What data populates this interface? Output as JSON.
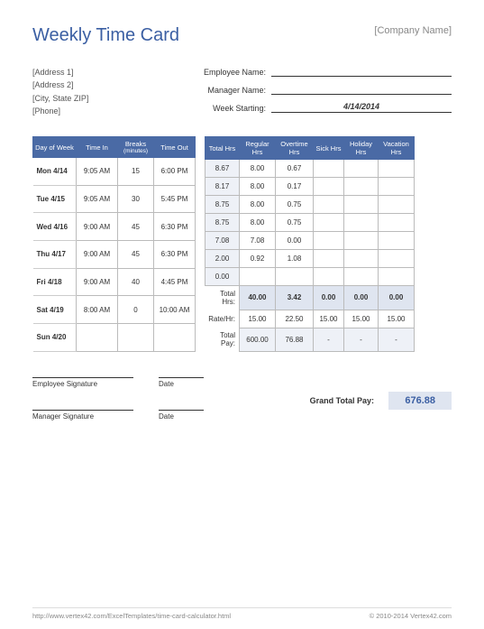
{
  "title": "Weekly Time Card",
  "company": "[Company Name]",
  "address": [
    "[Address 1]",
    "[Address 2]",
    "[City, State  ZIP]",
    "[Phone]"
  ],
  "fields": {
    "employee_label": "Employee Name:",
    "employee_value": "",
    "manager_label": "Manager Name:",
    "manager_value": "",
    "week_label": "Week Starting:",
    "week_value": "4/14/2014"
  },
  "time_table": {
    "headers": [
      "Day of Week",
      "Time In",
      "Breaks",
      "Time Out"
    ],
    "breaks_sub": "(minutes)",
    "rows": [
      {
        "day": "Mon 4/14",
        "in": "9:05 AM",
        "breaks": "15",
        "out": "6:00 PM"
      },
      {
        "day": "Tue 4/15",
        "in": "9:05 AM",
        "breaks": "30",
        "out": "5:45 PM"
      },
      {
        "day": "Wed 4/16",
        "in": "9:00 AM",
        "breaks": "45",
        "out": "6:30 PM"
      },
      {
        "day": "Thu 4/17",
        "in": "9:00 AM",
        "breaks": "45",
        "out": "6:30 PM"
      },
      {
        "day": "Fri 4/18",
        "in": "9:00 AM",
        "breaks": "40",
        "out": "4:45 PM"
      },
      {
        "day": "Sat 4/19",
        "in": "8:00 AM",
        "breaks": "0",
        "out": "10:00 AM"
      },
      {
        "day": "Sun 4/20",
        "in": "",
        "breaks": "",
        "out": ""
      }
    ]
  },
  "hrs_table": {
    "headers": [
      "Total Hrs",
      "Regular Hrs",
      "Overtime Hrs",
      "Sick Hrs",
      "Holiday Hrs",
      "Vacation Hrs"
    ],
    "rows": [
      {
        "total": "8.67",
        "reg": "8.00",
        "ot": "0.67",
        "sick": "",
        "hol": "",
        "vac": ""
      },
      {
        "total": "8.17",
        "reg": "8.00",
        "ot": "0.17",
        "sick": "",
        "hol": "",
        "vac": ""
      },
      {
        "total": "8.75",
        "reg": "8.00",
        "ot": "0.75",
        "sick": "",
        "hol": "",
        "vac": ""
      },
      {
        "total": "8.75",
        "reg": "8.00",
        "ot": "0.75",
        "sick": "",
        "hol": "",
        "vac": ""
      },
      {
        "total": "7.08",
        "reg": "7.08",
        "ot": "0.00",
        "sick": "",
        "hol": "",
        "vac": ""
      },
      {
        "total": "2.00",
        "reg": "0.92",
        "ot": "1.08",
        "sick": "",
        "hol": "",
        "vac": ""
      },
      {
        "total": "0.00",
        "reg": "",
        "ot": "",
        "sick": "",
        "hol": "",
        "vac": ""
      }
    ],
    "totals_label": "Total Hrs:",
    "totals": {
      "reg": "40.00",
      "ot": "3.42",
      "sick": "0.00",
      "hol": "0.00",
      "vac": "0.00"
    },
    "rate_label": "Rate/Hr:",
    "rates": {
      "reg": "15.00",
      "ot": "22.50",
      "sick": "15.00",
      "hol": "15.00",
      "vac": "15.00"
    },
    "pay_label": "Total Pay:",
    "pays": {
      "reg": "600.00",
      "ot": "76.88",
      "sick": "-",
      "hol": "-",
      "vac": "-"
    }
  },
  "signatures": {
    "emp": "Employee Signature",
    "mgr": "Manager Signature",
    "date": "Date"
  },
  "grand_label": "Grand Total Pay:",
  "grand_value": "676.88",
  "footer_left": "http://www.vertex42.com/ExcelTemplates/time-card-calculator.html",
  "footer_right": "© 2010-2014 Vertex42.com"
}
